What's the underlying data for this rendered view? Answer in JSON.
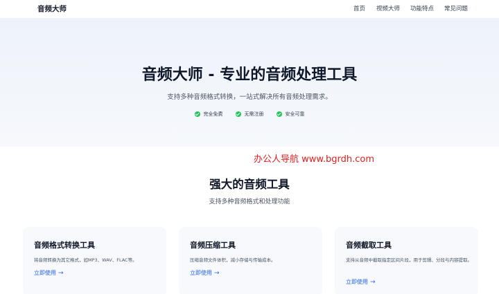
{
  "header": {
    "brand": "音频大师",
    "nav": [
      "首页",
      "视频大师",
      "功能特点",
      "常见问题"
    ]
  },
  "hero": {
    "title": "音频大师 - 专业的音频处理工具",
    "subtitle": "支持多种音频格式转换，一站式解决所有音频处理需求。",
    "badges": [
      "完全免费",
      "无需注册",
      "安全可靠"
    ]
  },
  "watermark": "办公人导航  www.bgrdh.com",
  "section": {
    "title": "强大的音频工具",
    "subtitle": "支持多种音频格式和处理功能"
  },
  "cards": [
    {
      "title": "音频格式转换工具",
      "desc": "将音频转换为其它格式，如MP3、WAV、FLAC等。",
      "link": "立即使用"
    },
    {
      "title": "音频压缩工具",
      "desc": "压缩音频文件体积，减小存储与传输成本。",
      "link": "立即使用"
    },
    {
      "title": "音频截取工具",
      "desc": "支持从音频中截取指定区间片段，用于剪辑、分段与内容提取。",
      "link": "立即使用"
    }
  ],
  "colors": {
    "accent": "#2563eb",
    "check": "#22c55e",
    "watermark": "#e11d1d"
  },
  "icons": {
    "badge": "check-circle-icon",
    "link": "arrow-right-icon"
  }
}
